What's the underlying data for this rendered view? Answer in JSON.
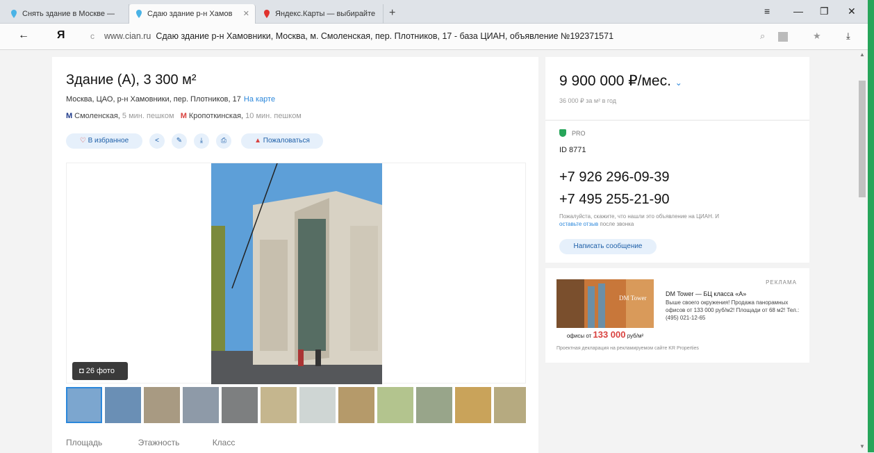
{
  "browser": {
    "tabs": [
      {
        "label": "Снять здание в Москве — ",
        "active": false
      },
      {
        "label": "Сдаю здание р-н Хамов",
        "active": true
      },
      {
        "label": "Яндекс.Карты — выбирайте",
        "active": false
      }
    ],
    "new_tab": "+",
    "window_buttons": {
      "menu": "≡",
      "minimize": "—",
      "restore": "❐",
      "close": "✕"
    },
    "back": "←",
    "logo": "Я",
    "domain": "www.cian.ru",
    "page_title": "Сдаю здание р-н Хамовники, Москва, м. Смоленская, пер. Плотников, 17 - база ЦИАН, объявление №192371571"
  },
  "listing": {
    "title": "Здание (A), 3 300 м²",
    "address": "Москва, ЦАО, р-н Хамовники, пер. Плотников, 17",
    "map_link": "На карте",
    "metro": [
      {
        "name": "Смоленская",
        "time": "5 мин. пешком",
        "color": "#1e3a8a"
      },
      {
        "name": "Кропоткинская",
        "time": "10 мин. пешком",
        "color": "#d9423f"
      }
    ],
    "actions": {
      "favorite": "В избранное",
      "complain": "Пожаловаться"
    },
    "photo_count": "26 фото",
    "params": [
      "Площадь",
      "Этажность",
      "Класс"
    ]
  },
  "price": {
    "value": "9 900 000 ₽/мес.",
    "per_meter": "36 000 ₽ за м² в год"
  },
  "contact": {
    "badge": "PRO",
    "id": "ID 8771",
    "phones": [
      "+7 926 296-09-39",
      "+7 495 255-21-90"
    ],
    "note_pre": "Пожалуйста, скажите, что нашли это объявление на ЦИАН. И",
    "note_link": "оставьте отзыв",
    "note_post": "после звонка",
    "message_button": "Написать сообщение"
  },
  "ad": {
    "label": "РЕКЛАМА",
    "title": "DM Tower — БЦ класса «А»",
    "text": "Выше своего окружения! Продажа панорамных офисов от 133 000 руб/м2! Площади от 68 м2! Тел.: (495) 021-12-65",
    "caption_pre": "офисы от",
    "caption_price": "133 000",
    "caption_unit": "руб/м²",
    "image_text": "DM Tower",
    "footer": "Проектная декларация на рекламируемом сайте KR Properties"
  }
}
